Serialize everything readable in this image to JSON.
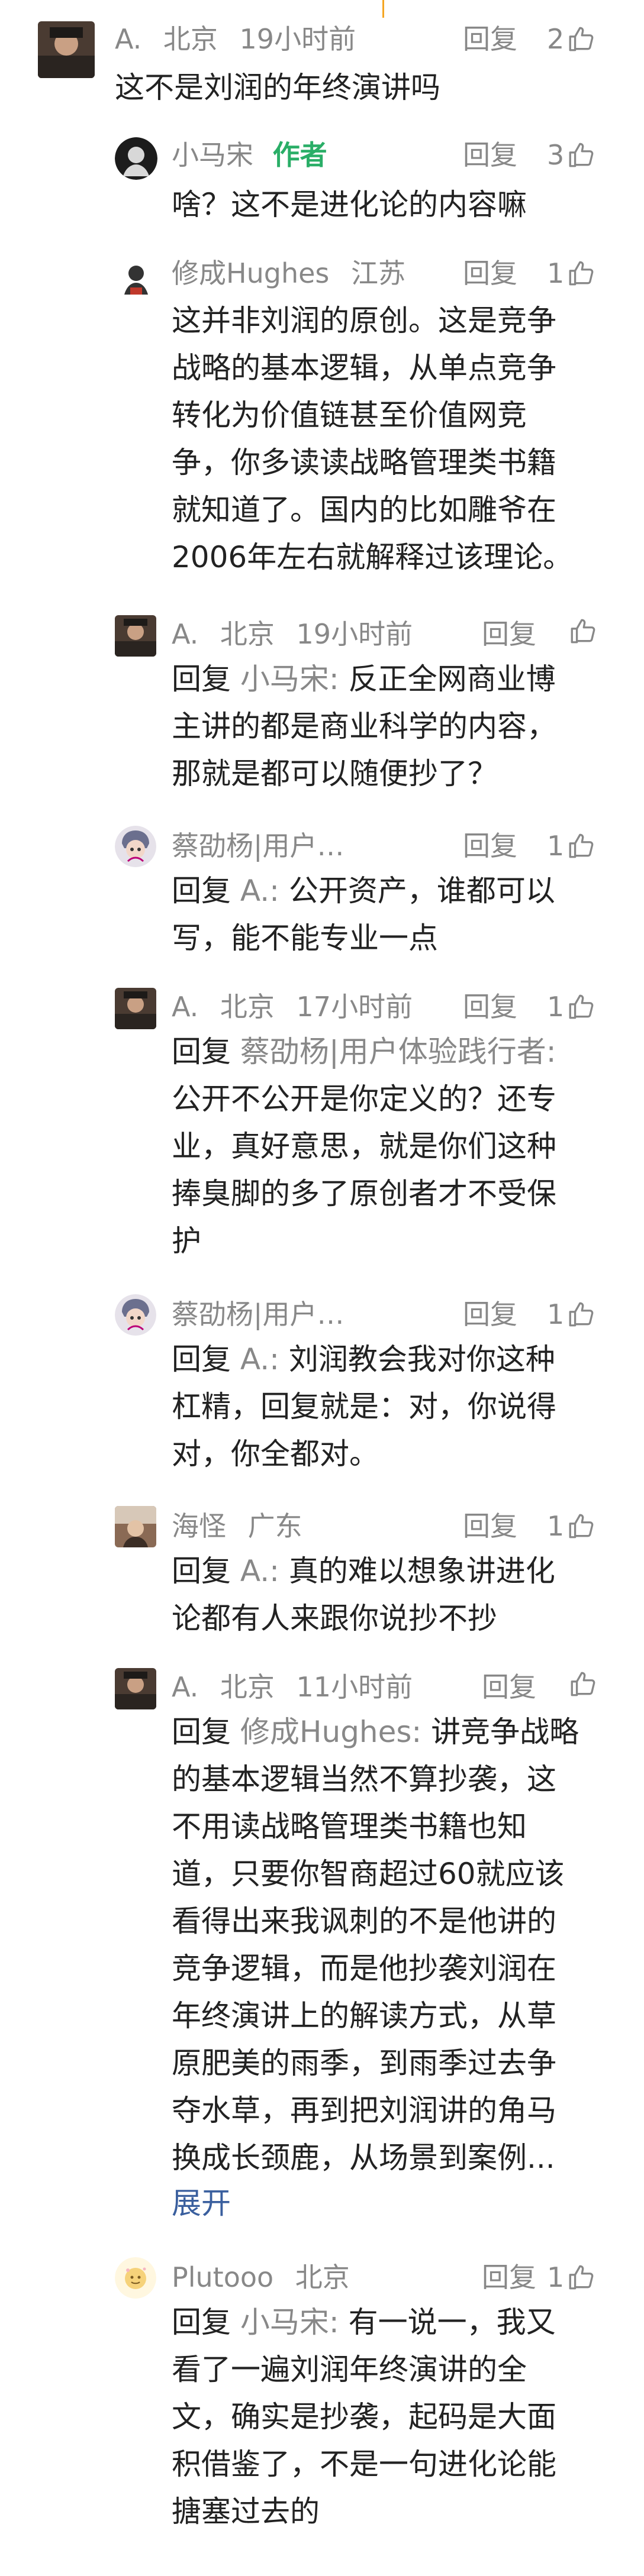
{
  "comments": [
    {
      "name": "A.",
      "location": "北京",
      "time": "19小时前",
      "reply_label": "回复",
      "likes": "2",
      "text": "这不是刘润的年终演讲吗"
    },
    {
      "name": "小马宋",
      "tag": "作者",
      "reply_label": "回复",
      "likes": "3",
      "text": "啥？这不是进化论的内容嘛"
    },
    {
      "name": "修成Hughes",
      "location": "江苏",
      "reply_label": "回复",
      "likes": "1",
      "text_lines": [
        "这并非刘润的原创。这是竞争",
        "战略的基本逻辑，从单点竞争",
        "转化为价值链甚至价值网竞",
        "争，你多读读战略管理类书籍",
        "就知道了。国内的比如雕爷在",
        "2006年左右就解释过该理论。"
      ]
    },
    {
      "name": "A.",
      "location": "北京",
      "time": "19小时前",
      "reply_label": "回复",
      "prefix": "回复",
      "target": "小马宋:",
      "text_first": "反正全网商业博",
      "text_lines": [
        "主讲的都是商业科学的内容，",
        "那就是都可以随便抄了？"
      ]
    },
    {
      "name": "蔡劭杨|用户…",
      "reply_label": "回复",
      "likes": "1",
      "prefix": "回复",
      "target": "A.:",
      "text_first": "公开资产，谁都可以",
      "text_lines": [
        "写，能不能专业一点"
      ]
    },
    {
      "name": "A.",
      "location": "北京",
      "time": "17小时前",
      "reply_label": "回复",
      "likes": "1",
      "prefix": "回复",
      "target": "蔡劭杨|用户体验践行者:",
      "text_lines": [
        "公开不公开是你定义的？还专",
        "业，真好意思，就是你们这种",
        "捧臭脚的多了原创者才不受保",
        "护"
      ]
    },
    {
      "name": "蔡劭杨|用户…",
      "reply_label": "回复",
      "likes": "1",
      "prefix": "回复",
      "target": "A.:",
      "text_first": "刘润教会我对你这种",
      "text_lines": [
        "杠精，回复就是：对，你说得",
        "对，你全都对。"
      ]
    },
    {
      "name": "海怪",
      "location": "广东",
      "reply_label": "回复",
      "likes": "1",
      "prefix": "回复",
      "target": "A.:",
      "text_first": "真的难以想象讲进化",
      "text_lines": [
        "论都有人来跟你说抄不抄"
      ]
    },
    {
      "name": "A.",
      "location": "北京",
      "time": "11小时前",
      "reply_label": "回复",
      "prefix": "回复",
      "target": "修成Hughes:",
      "text_first": "讲竞争战略",
      "text_lines": [
        "的基本逻辑当然不算抄袭，这",
        "不用读战略管理类书籍也知",
        "道，只要你智商超过60就应该",
        "看得出来我讽刺的不是他讲的",
        "竞争逻辑，而是他抄袭刘润在",
        "年终演讲上的解读方式，从草",
        "原肥美的雨季，到雨季过去争",
        "夺水草，再到把刘润讲的角马",
        "换成长颈鹿，从场景到案例..."
      ],
      "expand": "展开"
    },
    {
      "name": "Plutooo",
      "location": "北京",
      "reply_label": "回复",
      "likes": "1",
      "prefix": "回复",
      "target": "小马宋:",
      "text_first": "有一说一，我又",
      "text_lines": [
        "看了一遍刘润年终演讲的全",
        "文，确实是抄袭，起码是大面",
        "积借鉴了，不是一句进化论能",
        "搪塞过去的"
      ]
    }
  ],
  "icons": {
    "like": "thumbs-up-icon"
  },
  "colors": {
    "author_tag": "#2aae67",
    "link": "#3a5f9e",
    "meta": "#888888"
  }
}
